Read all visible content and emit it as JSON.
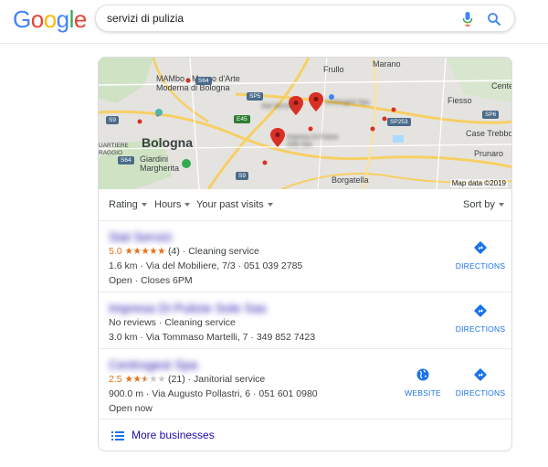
{
  "logo": {
    "letters": [
      "G",
      "o",
      "o",
      "g",
      "l",
      "e"
    ],
    "colors": [
      "#4285F4",
      "#EA4335",
      "#FBBC05",
      "#4285F4",
      "#34A853",
      "#EA4335"
    ]
  },
  "search": {
    "query": "servizi di pulizia"
  },
  "map": {
    "labels": {
      "frullo": "Frullo",
      "marano": "Marano",
      "mambo": "MAMbo - Museo d'Arte Moderna di Bologna",
      "fiesso": "Fiesso",
      "cente": "Cente",
      "bologna": "Bologna",
      "quartiere": "UARTIERE RAGGIO",
      "giardini": "Giardini Margherita",
      "casetrebbo": "Case Trebbo",
      "prunaro": "Prunaro",
      "borgatella": "Borgatella",
      "pin1": "Sial Servizi",
      "pin2": "Centrogest Spa",
      "pin3": "Impresa Di Pulizie Sole Sas"
    },
    "routes": {
      "s64a": "S64",
      "sp5": "SP5",
      "s9a": "S9",
      "e45": "E45",
      "sp253": "SP253",
      "sp6": "SP6",
      "s64b": "S64",
      "s9b": "S9"
    },
    "attribution": "Map data ©2019"
  },
  "filters": {
    "rating": "Rating",
    "hours": "Hours",
    "visits": "Your past visits",
    "sort": "Sort by"
  },
  "listings": [
    {
      "name": "Sial Servizi",
      "rating": "5.0",
      "stars": 5,
      "reviews": "(4)",
      "category": "· Cleaning service",
      "address": "1.6 km · Via del Mobiliere, 7/3 · 051 039 2785",
      "hours": "Open · Closes 6PM",
      "directions": "DIRECTIONS"
    },
    {
      "name": "Impresa Di Pulizie Sole Sas",
      "reviews_text": "No reviews · Cleaning service",
      "address": "3.0 km · Via Tommaso Martelli, 7 · 349 852 7423",
      "directions": "DIRECTIONS"
    },
    {
      "name": "Centrogest Spa",
      "rating": "2.5",
      "stars": 2.5,
      "reviews": "(21)",
      "category": "· Janitorial service",
      "address": "900.0 m · Via Augusto Pollastri, 6 · 051 601 0980",
      "hours": "Open now",
      "website": "WEBSITE",
      "directions": "DIRECTIONS"
    }
  ],
  "more": {
    "label": "More businesses"
  }
}
